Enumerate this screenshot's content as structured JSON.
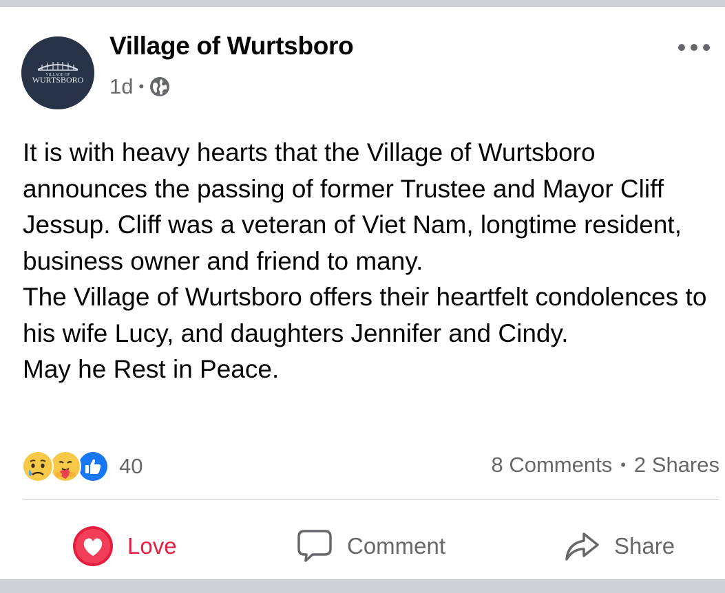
{
  "post": {
    "page_name": "Village of Wurtsboro",
    "logo_text_small": "VILLAGE OF",
    "logo_text": "WURTSBORO",
    "time": "1d",
    "separator": "•",
    "audience_icon": "globe-icon",
    "menu_icon": "more-options-icon",
    "paragraphs": [
      "It is with heavy hearts that the Village of Wurtsboro announces the passing of former Trustee and Mayor Cliff Jessup. Cliff was a veteran of Viet Nam, longtime resident, business owner and friend to many.",
      "The Village of Wurtsboro offers their heartfelt condolences to his wife Lucy, and daughters Jennifer and Cindy.",
      "May he Rest in Peace."
    ]
  },
  "engagement": {
    "reaction_icons": [
      "sad-reaction-icon",
      "care-reaction-icon",
      "like-reaction-icon"
    ],
    "reaction_count": "40",
    "comments": "8 Comments",
    "separator": "•",
    "shares": "2 Shares"
  },
  "actions": {
    "love_label": "Love",
    "comment_label": "Comment",
    "share_label": "Share"
  },
  "colors": {
    "love": "#e41e3f",
    "secondary_text": "#65676b",
    "avatar_bg": "#273346",
    "like_blue": "#1877f2"
  }
}
